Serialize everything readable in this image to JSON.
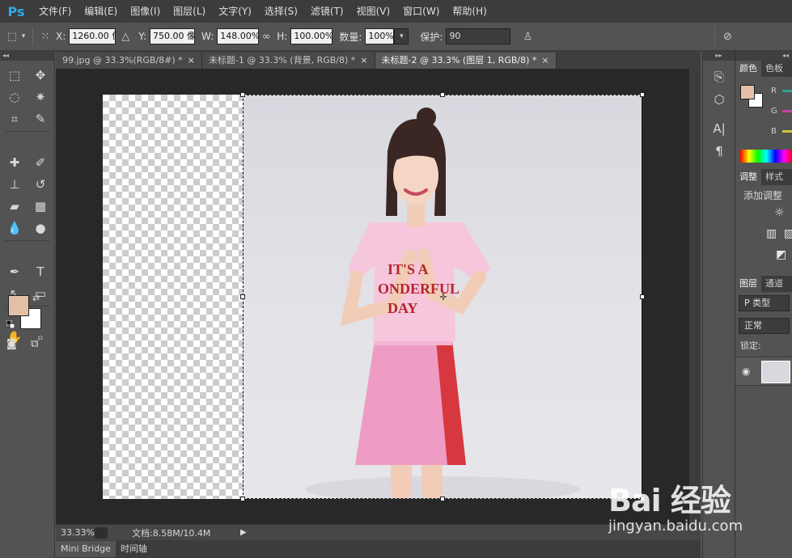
{
  "app": {
    "logo": "Ps"
  },
  "menu": [
    "文件(F)",
    "编辑(E)",
    "图像(I)",
    "图层(L)",
    "文字(Y)",
    "选择(S)",
    "滤镜(T)",
    "视图(V)",
    "窗口(W)",
    "帮助(H)"
  ],
  "options": {
    "x_label": "X:",
    "x_value": "1260.00 像",
    "y_label": "Y:",
    "y_value": "750.00 像素",
    "w_label": "W:",
    "w_value": "148.00%",
    "h_label": "H:",
    "h_value": "100.00%",
    "amount_label": "数量:",
    "amount_value": "100%",
    "protect_label": "保护:",
    "protect_value": "90"
  },
  "tabs": [
    {
      "label": "99.jpg @ 33.3%(RGB/8#) *",
      "close": "×"
    },
    {
      "label": "未标题-1 @ 33.3% (背景, RGB/8) *",
      "close": "×"
    },
    {
      "label": "未标题-2 @ 33.3% (图层 1, RGB/8) *",
      "close": "×"
    }
  ],
  "canvas": {
    "shirt_text_line1": "IT'S A",
    "shirt_text_line2": "ONDERFUL",
    "shirt_text_line3": "DAY"
  },
  "status": {
    "zoom": "33.33%",
    "doc_size": "文档:8.58M/10.4M"
  },
  "bottom_tabs": [
    "Mini Bridge",
    "时间轴"
  ],
  "panels": {
    "color_tabs": [
      "颜色",
      "色板"
    ],
    "channels": [
      "R",
      "G",
      "B"
    ],
    "adjust_tabs": [
      "调整",
      "样式"
    ],
    "adjust_add": "添加调整",
    "layers_tabs": [
      "图层",
      "通道"
    ],
    "kind_label": "P 类型",
    "blend_mode": "正常",
    "lock_label": "锁定:"
  },
  "watermark": {
    "logo": "Bai 经验",
    "url": "jingyan.baidu.com"
  },
  "colors": {
    "foreground": "#e4c0a6",
    "background": "#ffffff",
    "accent": "#30a7e6"
  }
}
